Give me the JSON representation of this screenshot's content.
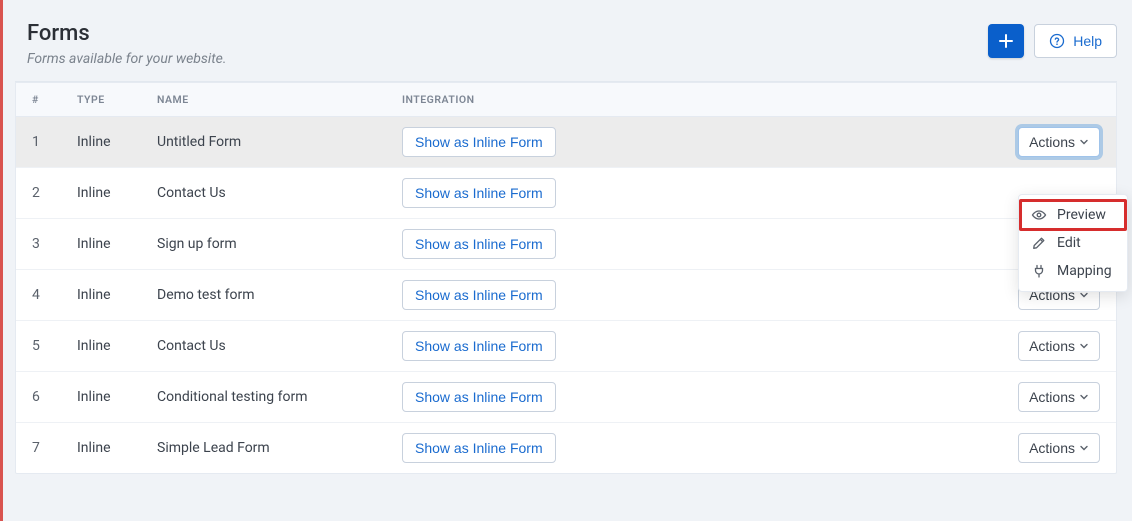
{
  "header": {
    "title": "Forms",
    "subtitle": "Forms available for your website.",
    "help_label": "Help"
  },
  "table": {
    "columns": {
      "num": "#",
      "type": "TYPE",
      "name": "NAME",
      "integration": "INTEGRATION"
    },
    "integration_btn_label": "Show as Inline Form",
    "actions_btn_label": "Actions",
    "rows": [
      {
        "num": "1",
        "type": "Inline",
        "name": "Untitled Form",
        "highlight": true,
        "focused_actions": true,
        "show_actions_btn": true
      },
      {
        "num": "2",
        "type": "Inline",
        "name": "Contact Us",
        "show_actions_btn": false
      },
      {
        "num": "3",
        "type": "Inline",
        "name": "Sign up form",
        "show_actions_btn": false
      },
      {
        "num": "4",
        "type": "Inline",
        "name": "Demo test form",
        "show_actions_btn": true
      },
      {
        "num": "5",
        "type": "Inline",
        "name": "Contact Us",
        "show_actions_btn": true
      },
      {
        "num": "6",
        "type": "Inline",
        "name": "Conditional testing form",
        "show_actions_btn": true
      },
      {
        "num": "7",
        "type": "Inline",
        "name": "Simple Lead Form",
        "show_actions_btn": true
      }
    ]
  },
  "dropdown": {
    "items": [
      {
        "label": "Preview",
        "icon": "eye-icon",
        "highlighted": true
      },
      {
        "label": "Edit",
        "icon": "pencil-icon"
      },
      {
        "label": "Mapping",
        "icon": "plug-icon"
      }
    ]
  }
}
